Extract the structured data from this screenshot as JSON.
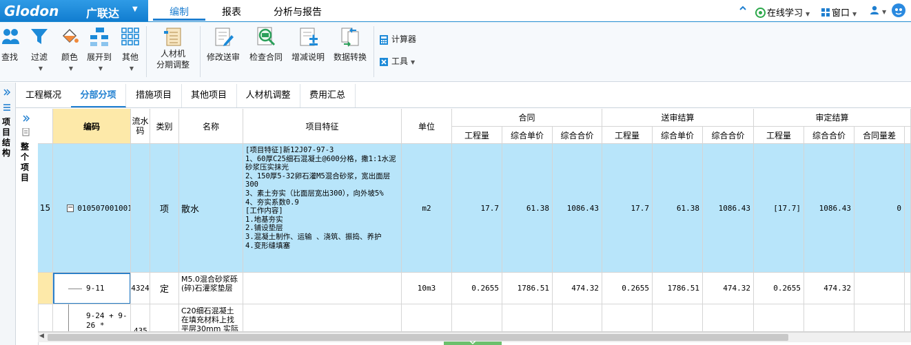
{
  "topbar": {
    "brand": "Glodon",
    "brand_cn": "广联达",
    "dropdown": "▼",
    "main_tabs": [
      {
        "label": "编制"
      },
      {
        "label": "报表"
      },
      {
        "label": "分析与报告"
      }
    ],
    "collapse_icon": "chevron-up-icon",
    "online_learning": "在线学习",
    "window": "窗口",
    "accent_color": "#1f7fd0"
  },
  "ribbon": {
    "buttons": [
      {
        "label": "查找",
        "icon": "find-people-icon"
      },
      {
        "label": "过滤",
        "icon": "filter-icon"
      },
      {
        "label": "颜色",
        "icon": "paint-bucket-icon"
      },
      {
        "label": "展开到",
        "icon": "expand-tree-icon"
      },
      {
        "label": "其他",
        "icon": "grid-dots-icon"
      },
      {
        "label": "人材机",
        "label2": "分期调整",
        "icon": "ledger-icon"
      },
      {
        "label": "修改送审",
        "icon": "edit-document-icon"
      },
      {
        "label": "检查合同",
        "icon": "magnify-contract-icon"
      },
      {
        "label": "增减说明",
        "icon": "add-note-icon"
      },
      {
        "label": "数据转换",
        "icon": "data-convert-icon"
      }
    ],
    "calculator": "计算器",
    "tools": "工具"
  },
  "left_panel": {
    "title": "项目结构"
  },
  "tree_panel": {
    "title": "整个项目"
  },
  "sub_tabs": [
    {
      "label": "工程概况"
    },
    {
      "label": "分部分项"
    },
    {
      "label": "措施项目"
    },
    {
      "label": "其他项目"
    },
    {
      "label": "人材机调整"
    },
    {
      "label": "费用汇总"
    }
  ],
  "table": {
    "headers": {
      "code": "编码",
      "serial": "流水码",
      "type": "类别",
      "name": "名称",
      "feature": "项目特征",
      "unit": "单位",
      "contract": "合同",
      "submitted": "送审结算",
      "approved": "审定结算",
      "qty": "工程量",
      "unit_price": "综合单价",
      "total": "综合合价",
      "contract_diff": "合同量差"
    },
    "rows": [
      {
        "index": "15",
        "expand": "−",
        "code": "010507001001",
        "serial": "",
        "type": "项",
        "name": "散水",
        "feature": "[项目特征]新12J07-97-3\n1、60厚C25细石混凝土@600分格，撒1:1水泥砂浆压实抹光\n2、150厚5-32卵石灌M5混合砂浆，宽出面层300\n3、素土夯实（比面层宽出300），向外坡5%\n4、夯实系数0.9\n[工作内容]\n1.地基夯实\n2.铺设垫层\n3.混凝土制作、运输 、浇筑、振捣、养护\n4.变形缝填塞",
        "unit": "m2",
        "c_qty": "17.7",
        "c_price": "61.38",
        "c_total": "1086.43",
        "s_qty": "17.7",
        "s_price": "61.38",
        "s_total": "1086.43",
        "a_qty": "[17.7]",
        "a_total": "1086.43",
        "a_diff": "0"
      },
      {
        "index": "",
        "code": "9-11",
        "serial": "4324",
        "type": "定",
        "name": "M5.0混合砂浆砾(碎)石灌浆垫层",
        "feature": "",
        "unit": "10m3",
        "c_qty": "0.2655",
        "c_price": "1786.51",
        "c_total": "474.32",
        "s_qty": "0.2655",
        "s_price": "1786.51",
        "s_total": "474.32",
        "a_qty": "0.2655",
        "a_total": "474.32",
        "a_diff": ""
      },
      {
        "index": "",
        "code": "9-24 + 9-26 *",
        "serial": "435",
        "type": "",
        "name": "C20细石混凝土在填充材料上找平层30mm 实际",
        "feature": "",
        "unit": ""
      }
    ]
  }
}
